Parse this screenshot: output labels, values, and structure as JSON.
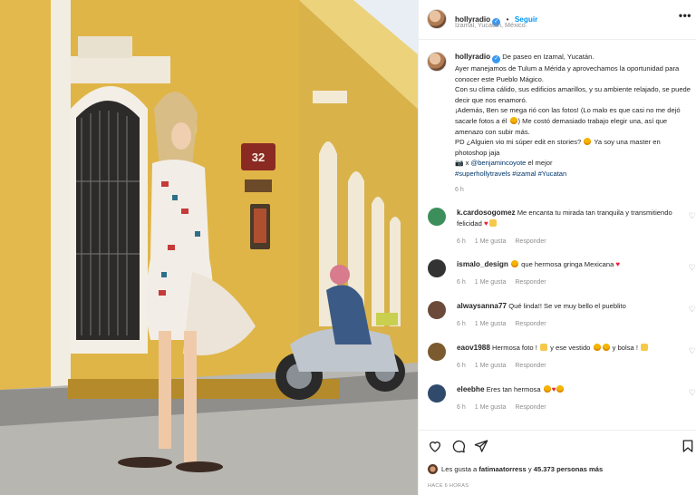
{
  "post": {
    "username": "hollyradio",
    "follow_label": "Seguir",
    "location": "Izamal, Yucatán, México.",
    "more_icon": "more-options-icon"
  },
  "photo": {
    "sign_number": "32",
    "alt": "street photo"
  },
  "caption": {
    "username": "hollyradio",
    "lines": [
      "De paseo en Izamal, Yucatán.",
      "Ayer manejamos de Tulum a Mérida y aprovechamos la oportunidad para conocer este Pueblo Mágico.",
      "Con su clima cálido, sus edificios amarillos, y su ambiente relajado, se puede decir que nos enamoró.",
      "¡Además, Ben se mega rió con las fotos! (Lo malo es que casi no me dejó sacarle fotos a él",
      ") Me costó demasiado trabajo elegir una, así que amenazo con subir más.",
      "PD ¿Alguien vio mi súper edit en stories?",
      "Ya soy una master en photoshop jaja",
      " x ",
      "@benjamincoyote",
      " el mejor",
      "#superhollytravels #izamal #Yucatan"
    ],
    "time": "6 h"
  },
  "comments": [
    {
      "user": "k.cardosogomez",
      "text": "Me encanta tu mirada tan tranquila y transmitiendo felicidad",
      "time": "6 h",
      "likes": "1 Me gusta",
      "reply": "Responder",
      "av": "#3c8f5a"
    },
    {
      "user": "ismalo_design",
      "text": "que hermosa gringa Mexicana",
      "time": "6 h",
      "likes": "1 Me gusta",
      "reply": "Responder",
      "av": "#333333"
    },
    {
      "user": "alwaysanna77",
      "text": "Qué linda!! Se ve muy bello el pueblito",
      "time": "6 h",
      "likes": "1 Me gusta",
      "reply": "Responder",
      "av": "#6b4a3a"
    },
    {
      "user": "eaov1988",
      "text": "Hermosa foto !",
      "text2": "y ese vestido",
      "text3": "y bolsa !",
      "time": "6 h",
      "likes": "1 Me gusta",
      "reply": "Responder",
      "av": "#7a5a2e"
    },
    {
      "user": "eleebhe",
      "text": "Eres tan hermosa",
      "time": "6 h",
      "likes": "1 Me gusta",
      "reply": "Responder",
      "av": "#2f4a6b"
    }
  ],
  "footer": {
    "likes_prefix": "Les gusta a ",
    "likes_user": "fatimaatorress",
    "likes_mid": " y ",
    "likes_count": "45.373",
    "likes_suffix": " personas más",
    "ago": "HACE 6 HORAS"
  }
}
